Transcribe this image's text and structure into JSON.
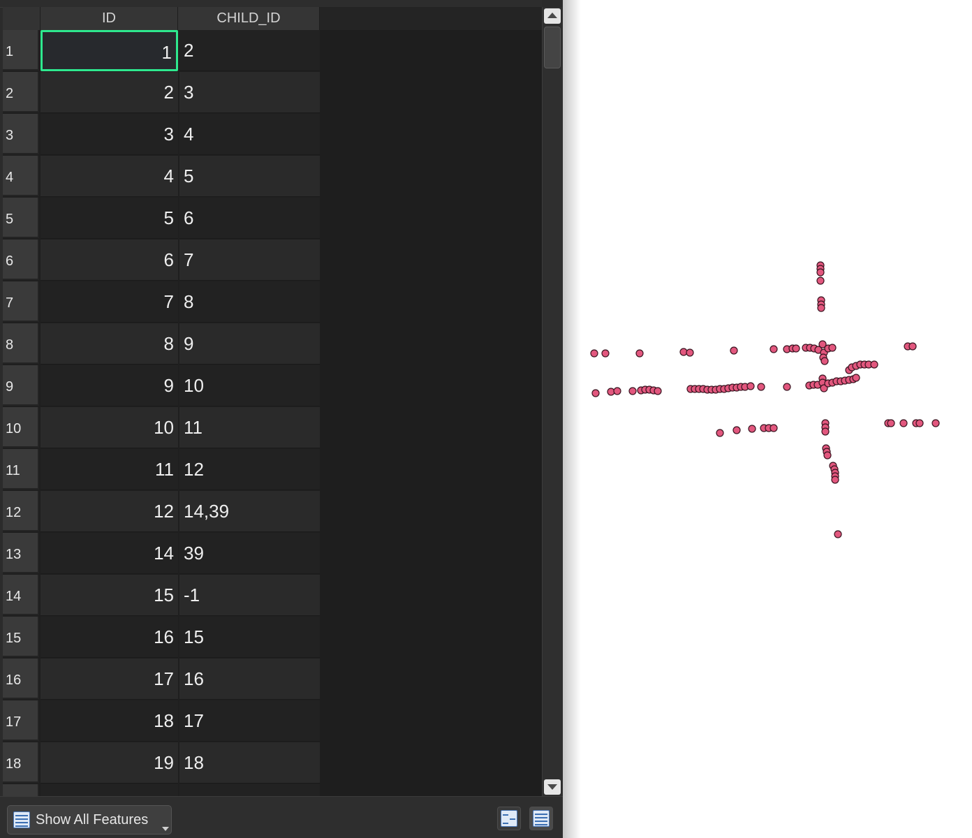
{
  "attribute_table": {
    "columns": [
      "ID",
      "CHILD_ID"
    ],
    "selected_cell": {
      "row": 1,
      "column": "ID"
    },
    "rows": [
      {
        "num": "1",
        "id": "1",
        "child": "2"
      },
      {
        "num": "2",
        "id": "2",
        "child": "3"
      },
      {
        "num": "3",
        "id": "3",
        "child": "4"
      },
      {
        "num": "4",
        "id": "4",
        "child": "5"
      },
      {
        "num": "5",
        "id": "5",
        "child": "6"
      },
      {
        "num": "6",
        "id": "6",
        "child": "7"
      },
      {
        "num": "7",
        "id": "7",
        "child": "8"
      },
      {
        "num": "8",
        "id": "8",
        "child": "9"
      },
      {
        "num": "9",
        "id": "9",
        "child": "10"
      },
      {
        "num": "10",
        "id": "10",
        "child": "11"
      },
      {
        "num": "11",
        "id": "11",
        "child": "12"
      },
      {
        "num": "12",
        "id": "12",
        "child": "14,39"
      },
      {
        "num": "13",
        "id": "14",
        "child": "39"
      },
      {
        "num": "14",
        "id": "15",
        "child": "-1"
      },
      {
        "num": "15",
        "id": "16",
        "child": "15"
      },
      {
        "num": "16",
        "id": "17",
        "child": "16"
      },
      {
        "num": "17",
        "id": "18",
        "child": "17"
      },
      {
        "num": "18",
        "id": "19",
        "child": "18"
      }
    ]
  },
  "bottom_bar": {
    "filter_label": "Show All Features",
    "form_view_icon": "form-view-icon",
    "table_view_icon": "table-view-icon"
  },
  "map": {
    "point_color": "#e2577e",
    "point_outline": "#3a1420"
  }
}
